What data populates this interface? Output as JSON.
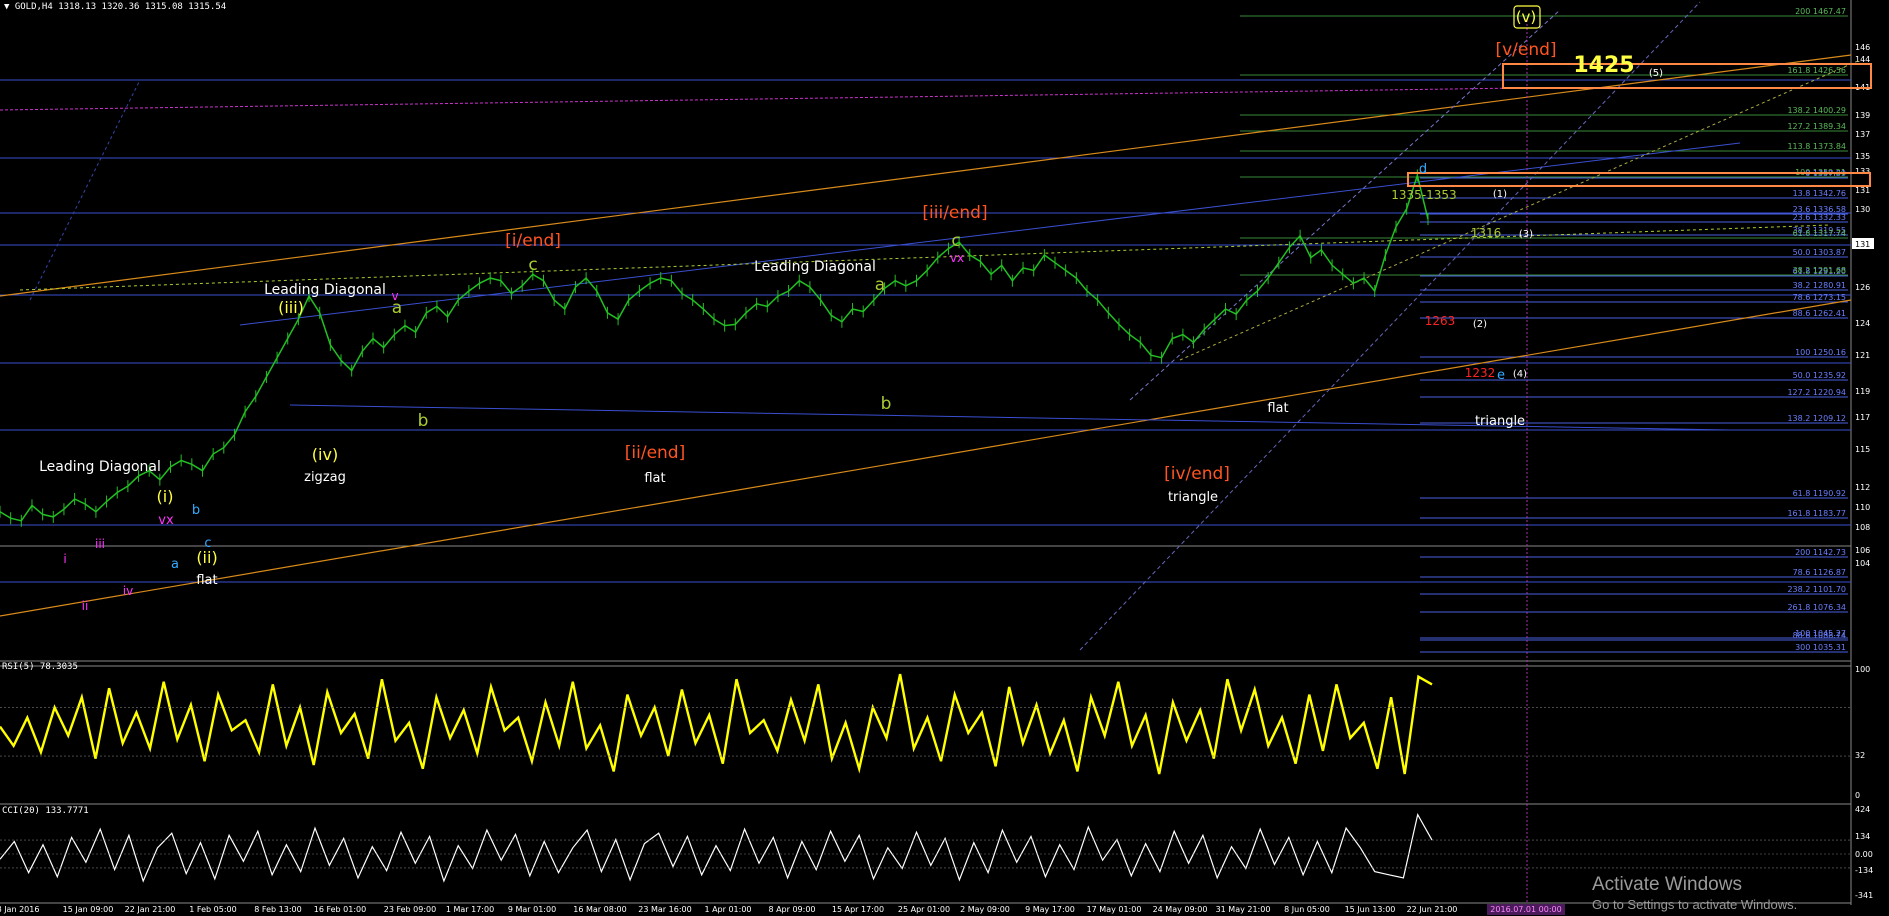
{
  "header": {
    "symbol": "GOLD,H4",
    "ohlc": "1318.13 1320.36 1315.08 1315.54",
    "rsi": "RSI(5) 78.3035",
    "cci": "CCI(20) 133.7771"
  },
  "watermark": {
    "line1": "Activate Windows",
    "line2": "Go to Settings to activate Windows."
  },
  "colors": {
    "price": "#22c022",
    "rsi": "#ffff00",
    "cci": "#ffffff",
    "blue_line": "#3a4fd0",
    "orange_line": "#d88a1a",
    "fib_green": "#3a8a3a",
    "magenta": "#ff33ff",
    "cyan": "#33aaff",
    "yellow": "#ffff44",
    "green_yellow": "#aacc33",
    "white": "#ffffff",
    "orange_red": "#ff5522",
    "red": "#ff2222",
    "box": "#ff8844"
  },
  "chart_data": [
    {
      "type": "line",
      "title": "GOLD,H4",
      "ylim": [
        1040,
        1480
      ],
      "y_ticks": [
        "146",
        "144",
        "141",
        "139",
        "137",
        "135",
        "133",
        "131",
        "130",
        "128",
        "126",
        "124",
        "121",
        "119",
        "117",
        "115",
        "112",
        "110",
        "108",
        "106",
        "104"
      ],
      "x_ticks": [
        "8 Jan 2016",
        "15 Jan 09:00",
        "22 Jan 21:00",
        "1 Feb 05:00",
        "8 Feb 13:00",
        "16 Feb 01:00",
        "23 Feb 09:00",
        "1 Mar 17:00",
        "9 Mar 01:00",
        "16 Mar 08:00",
        "23 Mar 16:00",
        "1 Apr 01:00",
        "8 Apr 09:00",
        "15 Apr 17:00",
        "25 Apr 01:00",
        "2 May 09:00",
        "9 May 17:00",
        "17 May 01:00",
        "24 May 09:00",
        "31 May 21:00",
        "8 Jun 05:00",
        "15 Jun 13:00",
        "22 Jun 21:00"
      ],
      "x_tick_current": "2016.07.01 00:00",
      "right_axis_marker": "131",
      "series": [
        {
          "values": [
            1090,
            1085,
            1083,
            1095,
            1088,
            1086,
            1092,
            1100,
            1096,
            1090,
            1098,
            1105,
            1110,
            1118,
            1122,
            1115,
            1125,
            1130,
            1127,
            1122,
            1135,
            1140,
            1150,
            1168,
            1180,
            1195,
            1210,
            1225,
            1240,
            1258,
            1245,
            1220,
            1208,
            1200,
            1215,
            1225,
            1218,
            1228,
            1235,
            1230,
            1245,
            1250,
            1242,
            1255,
            1262,
            1268,
            1272,
            1270,
            1260,
            1266,
            1275,
            1270,
            1255,
            1248,
            1265,
            1272,
            1262,
            1245,
            1240,
            1255,
            1262,
            1268,
            1272,
            1270,
            1260,
            1255,
            1248,
            1240,
            1235,
            1236,
            1245,
            1252,
            1250,
            1258,
            1262,
            1270,
            1265,
            1255,
            1243,
            1238,
            1248,
            1246,
            1255,
            1264,
            1270,
            1266,
            1270,
            1278,
            1288,
            1295,
            1300,
            1290,
            1285,
            1275,
            1282,
            1270,
            1280,
            1278,
            1290,
            1284,
            1278,
            1272,
            1262,
            1255,
            1245,
            1236,
            1228,
            1222,
            1212,
            1210,
            1225,
            1228,
            1222,
            1232,
            1240,
            1248,
            1244,
            1255,
            1262,
            1272,
            1284,
            1296,
            1305,
            1288,
            1294,
            1282,
            1275,
            1268,
            1272,
            1262,
            1290,
            1312,
            1326,
            1352,
            1318
          ]
        },
        {
          "name": "RSI(5)",
          "values": [
            55,
            40,
            62,
            35,
            70,
            48,
            78,
            30,
            85,
            42,
            66,
            38,
            90,
            45,
            72,
            28,
            80,
            52,
            60,
            35,
            88,
            40,
            70,
            25,
            82,
            50,
            65,
            30,
            92,
            44,
            58,
            22,
            78,
            46,
            68,
            34,
            86,
            52,
            62,
            28,
            74,
            40,
            90,
            38,
            56,
            20,
            80,
            48,
            70,
            32,
            84,
            42,
            64,
            26,
            92,
            50,
            60,
            36,
            76,
            44,
            88,
            30,
            58,
            22,
            70,
            46,
            96,
            38,
            62,
            28,
            80,
            50,
            66,
            24,
            86,
            42,
            72,
            34,
            60,
            20,
            78,
            48,
            90,
            40,
            64,
            18,
            74,
            44,
            68,
            30,
            92,
            52,
            84,
            40,
            62,
            26,
            80,
            36,
            88,
            46,
            58,
            22,
            78,
            18,
            94,
            88
          ]
        },
        {
          "name": "CCI(20)",
          "values": [
            -50,
            120,
            -180,
            90,
            -220,
            160,
            -80,
            240,
            -150,
            180,
            -260,
            60,
            200,
            -190,
            110,
            -240,
            180,
            -70,
            220,
            -200,
            90,
            -170,
            250,
            -110,
            150,
            -230,
            70,
            -160,
            210,
            -90,
            170,
            -260,
            80,
            -140,
            230,
            -60,
            190,
            -210,
            120,
            -180,
            60,
            230,
            -170,
            140,
            -250,
            100,
            200,
            -120,
            170,
            -200,
            80,
            -160,
            240,
            -90,
            160,
            -230,
            120,
            -150,
            220,
            -70,
            180,
            -240,
            60,
            -140,
            210,
            -110,
            150,
            -250,
            110,
            -180,
            230,
            -80,
            170,
            -220,
            90,
            -150,
            260,
            -60,
            140,
            -210,
            100,
            -170,
            220,
            -90,
            180,
            -230,
            70,
            -140,
            240,
            -100,
            160,
            -200,
            120,
            -180,
            250,
            60,
            -170,
            -200,
            -230,
            380,
            134
          ]
        }
      ],
      "fib_levels": [
        {
          "label": "200 1467.47",
          "color": "#3a8a3a"
        },
        {
          "label": "161.8 1426.56",
          "color": "#3a8a3a"
        },
        {
          "label": "138.2 1400.29",
          "color": "#3a8a3a"
        },
        {
          "label": "127.2 1389.34",
          "color": "#3a8a3a"
        },
        {
          "label": "113.8 1373.84",
          "color": "#3a8a3a"
        },
        {
          "label": "100 1359.21",
          "color": "#3a8a3a"
        },
        {
          "label": "0 1357.59",
          "color": "#4a5fe0"
        },
        {
          "label": "13.8 1342.76",
          "color": "#4a5fe0"
        },
        {
          "label": "23.6 1336.58",
          "color": "#4a5fe0"
        },
        {
          "label": "23.6 1332.33",
          "color": "#4a5fe0"
        },
        {
          "label": "38.2 1319.55",
          "color": "#4a5fe0"
        },
        {
          "label": "61.8 1317.74",
          "color": "#3a8a3a"
        },
        {
          "label": "50.0 1303.87",
          "color": "#4a5fe0"
        },
        {
          "label": "61.8 1291.20",
          "color": "#4a5fe0"
        },
        {
          "label": "38.2 1291.68",
          "color": "#3a8a3a"
        },
        {
          "label": "38.2 1280.91",
          "color": "#4a5fe0"
        },
        {
          "label": "78.6 1273.15",
          "color": "#4a5fe0"
        },
        {
          "label": "88.6 1262.41",
          "color": "#4a5fe0"
        },
        {
          "label": "100 1250.16",
          "color": "#4a5fe0"
        },
        {
          "label": "50.0 1235.92",
          "color": "#4a5fe0"
        },
        {
          "label": "127.2 1220.94",
          "color": "#4a5fe0"
        },
        {
          "label": "138.2 1209.12",
          "color": "#4a5fe0"
        },
        {
          "label": "61.8 1190.92",
          "color": "#4a5fe0"
        },
        {
          "label": "161.8 1183.77",
          "color": "#4a5fe0"
        },
        {
          "label": "200 1142.73",
          "color": "#4a5fe0"
        },
        {
          "label": "78.6 1126.87",
          "color": "#4a5fe0"
        },
        {
          "label": "238.2 1101.70",
          "color": "#4a5fe0"
        },
        {
          "label": "88.6 1088.74",
          "color": "#4a5fe0"
        },
        {
          "label": "261.8 1076.34",
          "color": "#4a5fe0"
        },
        {
          "label": "100 1045.27",
          "color": "#4a5fe0"
        },
        {
          "label": "300 1035.31",
          "color": "#4a5fe0"
        }
      ],
      "rsi_ticks": [
        "100",
        "32",
        "0"
      ],
      "cci_ticks": [
        "424",
        "134",
        "0.00",
        "-134",
        "-341"
      ],
      "annotations": [
        {
          "text": "Leading Diagonal",
          "color": "#ffffff"
        },
        {
          "text": "Leading Diagonal",
          "color": "#ffffff"
        },
        {
          "text": "Leading Diagonal",
          "color": "#ffffff"
        },
        {
          "text": "(i)",
          "color": "#ffff44"
        },
        {
          "text": "vx",
          "color": "#ff33ff"
        },
        {
          "text": "(ii)",
          "color": "#ffff44"
        },
        {
          "text": "flat",
          "color": "#ffffff"
        },
        {
          "text": "(iii)",
          "color": "#ffff44"
        },
        {
          "text": "(iv)",
          "color": "#ffff44"
        },
        {
          "text": "zigzag",
          "color": "#ffffff"
        },
        {
          "text": "[i/end]",
          "color": "#ff5522"
        },
        {
          "text": "[ii/end]",
          "color": "#ff5522"
        },
        {
          "text": "flat",
          "color": "#ffffff"
        },
        {
          "text": "[iii/end]",
          "color": "#ff5522"
        },
        {
          "text": "[iv/end]",
          "color": "#ff5522"
        },
        {
          "text": "triangle",
          "color": "#ffffff"
        },
        {
          "text": "flat",
          "color": "#ffffff"
        },
        {
          "text": "[v/end]",
          "color": "#ff5522"
        },
        {
          "text": "1425",
          "color": "#ffff44"
        },
        {
          "text": "(v)",
          "color": "#ffff44"
        },
        {
          "text": "(5)",
          "color": "#ffffff"
        },
        {
          "text": "1335-1353",
          "color": "#aacc33"
        },
        {
          "text": "(1)",
          "color": "#ffffff"
        },
        {
          "text": "1316",
          "color": "#aacc33"
        },
        {
          "text": "(3)",
          "color": "#ffffff"
        },
        {
          "text": "1263",
          "color": "#ff2222"
        },
        {
          "text": "(2)",
          "color": "#ffffff"
        },
        {
          "text": "1232",
          "color": "#ff2222"
        },
        {
          "text": "(4)",
          "color": "#ffffff"
        },
        {
          "text": "triangle",
          "color": "#ffffff"
        },
        {
          "text": "c",
          "color": "#aacc33"
        },
        {
          "text": "c",
          "color": "#aacc33"
        },
        {
          "text": "a",
          "color": "#aacc33"
        },
        {
          "text": "b",
          "color": "#aacc33"
        },
        {
          "text": "a",
          "color": "#aacc33"
        },
        {
          "text": "b",
          "color": "#aacc33"
        },
        {
          "text": "i",
          "color": "#ff33ff"
        },
        {
          "text": "ii",
          "color": "#ff33ff"
        },
        {
          "text": "iii",
          "color": "#ff33ff"
        },
        {
          "text": "iv",
          "color": "#ff33ff"
        },
        {
          "text": "v",
          "color": "#ff33ff"
        },
        {
          "text": "vx",
          "color": "#ff33ff"
        },
        {
          "text": "a",
          "color": "#33aaff"
        },
        {
          "text": "b",
          "color": "#33aaff"
        },
        {
          "text": "c",
          "color": "#33aaff"
        },
        {
          "text": "d",
          "color": "#33aaff"
        },
        {
          "text": "e",
          "color": "#33aaff"
        }
      ]
    }
  ]
}
